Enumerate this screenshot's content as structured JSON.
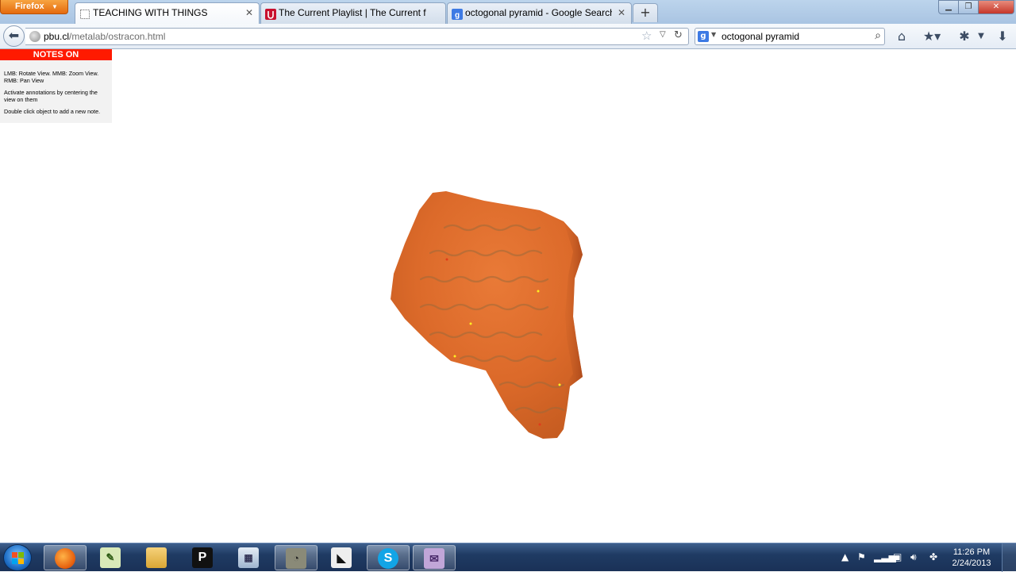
{
  "browser": {
    "menu_button": "Firefox",
    "tabs": [
      {
        "label": "TEACHING WITH THINGS",
        "active": true
      },
      {
        "label": "The Current Playlist | The Current fro...",
        "active": false
      },
      {
        "label": "octogonal pyramid - Google Search",
        "active": false
      }
    ],
    "new_tab": "+",
    "address": {
      "host": "pbu.cl",
      "path": "/metalab/ostracon.html"
    },
    "search": {
      "value": "octogonal pyramid"
    }
  },
  "page": {
    "notes_toggle": "NOTES ON",
    "help": [
      "LMB: Rotate View. MMB: Zoom View. RMB: Pan View",
      "Activate annotations by centering the view on them",
      "Double click object to add a new note."
    ],
    "annotation_marker_color": "#ffee22",
    "object_color": "#e2702e"
  },
  "taskbar": {
    "clock_time": "11:26 PM",
    "clock_date": "2/24/2013"
  }
}
